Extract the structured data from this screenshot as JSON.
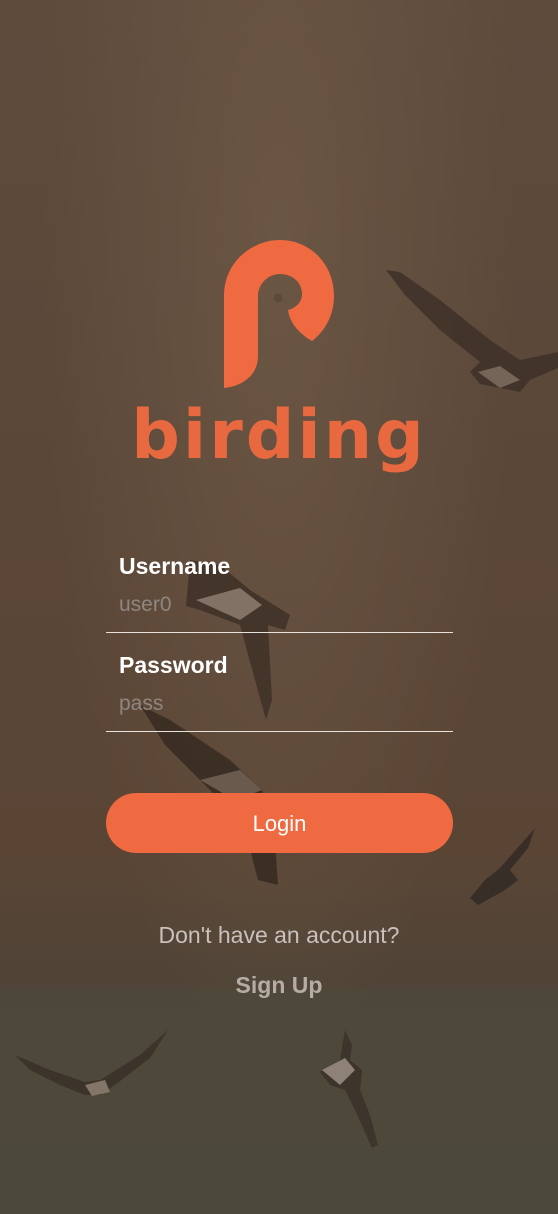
{
  "app": {
    "brand_name": "birding",
    "brand_color": "#ef6a40"
  },
  "form": {
    "username": {
      "label": "Username",
      "placeholder": "user0",
      "value": ""
    },
    "password": {
      "label": "Password",
      "placeholder": "pass",
      "value": ""
    },
    "login_label": "Login"
  },
  "footer": {
    "prompt": "Don't have an account?",
    "signup_label": "Sign Up"
  },
  "background": {
    "subject": "flying-seagulls-over-sea-at-dusk"
  }
}
